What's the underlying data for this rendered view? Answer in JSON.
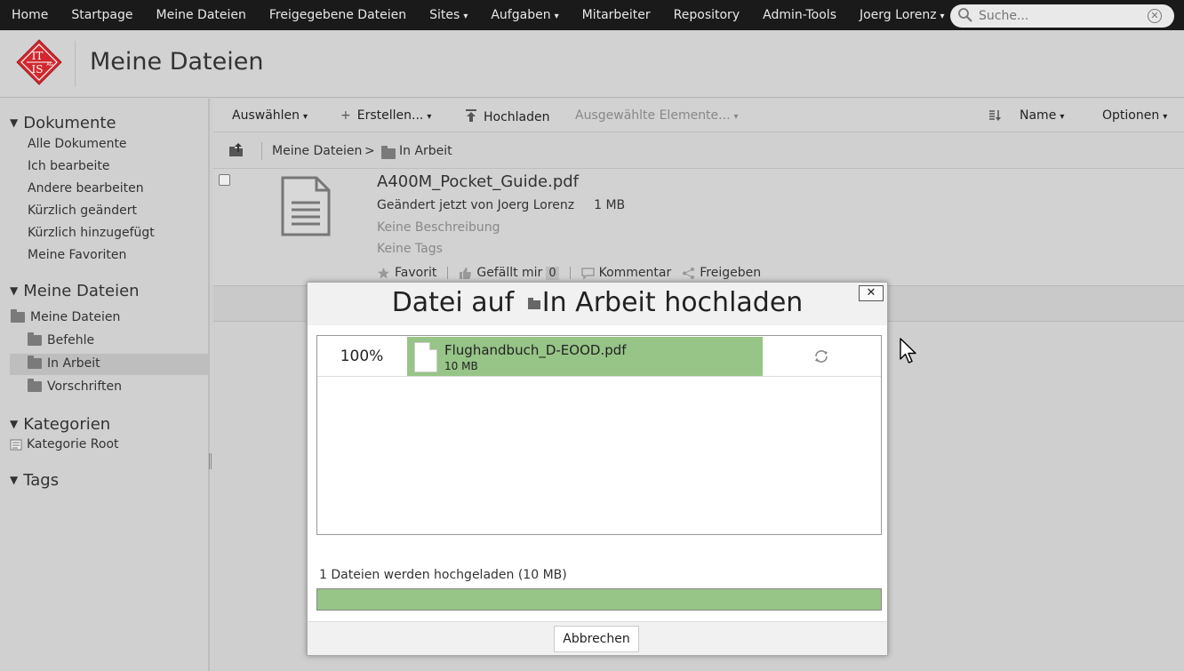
{
  "topnav": {
    "items": [
      {
        "label": "Home"
      },
      {
        "label": "Startpage"
      },
      {
        "label": "Meine Dateien"
      },
      {
        "label": "Freigegebene Dateien"
      },
      {
        "label": "Sites",
        "caret": "▾"
      },
      {
        "label": "Aufgaben",
        "caret": "▾"
      },
      {
        "label": "Mitarbeiter"
      },
      {
        "label": "Repository"
      },
      {
        "label": "Admin-Tools"
      },
      {
        "label": "Joerg Lorenz",
        "caret": "▾"
      }
    ],
    "search_placeholder": "Suche...",
    "clear_symbol": "✕"
  },
  "header": {
    "logo_text_top": "IT",
    "logo_text_bottom": "IS",
    "logo_text_small": "AG",
    "title": "Meine Dateien"
  },
  "sidebar": {
    "dokumente": {
      "heading": "Dokumente",
      "links": [
        "Alle Dokumente",
        "Ich bearbeite",
        "Andere bearbeiten",
        "Kürzlich geändert",
        "Kürzlich hinzugefügt",
        "Meine Favoriten"
      ]
    },
    "meine_dateien": {
      "heading": "Meine Dateien",
      "root": "Meine Dateien",
      "children": [
        "Befehle",
        "In Arbeit",
        "Vorschriften"
      ]
    },
    "kategorien": {
      "heading": "Kategorien",
      "root": "Kategorie Root"
    },
    "tags": {
      "heading": "Tags"
    },
    "toggle_symbol": "▼"
  },
  "toolbar": {
    "select": "Auswählen",
    "create": "Erstellen...",
    "upload": "Hochladen",
    "selected_items": "Ausgewählte Elemente...",
    "sort_name": "Name",
    "options": "Optionen",
    "caret": "▾",
    "plus": "+"
  },
  "breadcrumb": {
    "root": "Meine Dateien",
    "separator": ">",
    "current": "In Arbeit"
  },
  "document": {
    "name": "A400M_Pocket_Guide.pdf",
    "modified": "Geändert jetzt von Joerg Lorenz",
    "size": "1 MB",
    "description": "Keine Beschreibung",
    "tags": "Keine Tags",
    "favorite": "Favorit",
    "like": "Gefällt mir",
    "like_count": "0",
    "comment": "Kommentar",
    "share": "Freigeben"
  },
  "upload_dialog": {
    "title_prefix": "Datei auf",
    "title_folder": "In Arbeit",
    "title_suffix": "hochladen",
    "close_symbol": "✕",
    "file": {
      "percent": "100%",
      "progress": 1.0,
      "name": "Flughandbuch_D-EOOD.pdf",
      "size": "10 MB"
    },
    "status": "1 Dateien werden hochgeladen (10 MB)",
    "total_progress": 1.0,
    "cancel": "Abbrechen"
  },
  "colors": {
    "nav_bg": "#1a1a1a",
    "progress_green": "#97c487",
    "logo_red": "#d0282e"
  }
}
